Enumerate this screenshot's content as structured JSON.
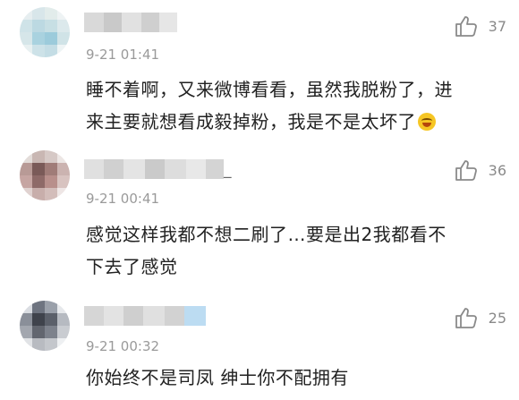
{
  "comments": [
    {
      "time": "9-21 01:41",
      "likes": "37",
      "text_lines": [
        "睡不着啊，又来微博看看，虽然我脱粉了，进",
        "来主要就想看成毅掉粉，我是不是太坏了"
      ],
      "emoji": "laughing-crying"
    },
    {
      "name_tail": "_",
      "time": "9-21 00:41",
      "likes": "36",
      "text_lines": [
        "感觉这样我都不想二刷了…要是出2我都看不",
        "下去了感觉"
      ]
    },
    {
      "time": "9-21 00:32",
      "likes": "25",
      "text_lines": [
        "你始终不是司凤 绅士你不配拥有"
      ]
    }
  ],
  "icons": {
    "like": "thumbs-up-icon"
  },
  "colors": {
    "text": "#222222",
    "meta": "#9a9a9a",
    "like_icon": "#8a8a8a"
  }
}
